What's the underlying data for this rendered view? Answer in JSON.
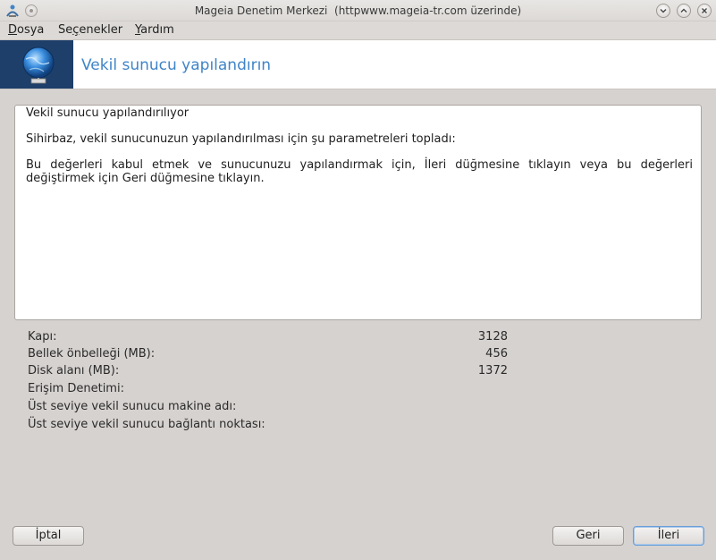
{
  "window": {
    "title": "Mageia Denetim Merkezi  (httpwww.mageia-tr.com üzerinde)"
  },
  "menu": {
    "file": {
      "mnemonic": "D",
      "rest": "osya"
    },
    "options": {
      "before": "Se",
      "mnemonic": "ç",
      "after": "enekler"
    },
    "help": {
      "mnemonic": "Y",
      "rest": "ardım"
    }
  },
  "banner": {
    "title": "Vekil sunucu yapılandırın"
  },
  "summary": {
    "heading": "Vekil sunucu yapılandırılıyor",
    "intro": "Sihirbaz, vekil sunucunuzun yapılandırılması için şu parametreleri topladı:",
    "instruction": "Bu değerleri kabul etmek ve sunucunuzu yapılandırmak için, İleri düğmesine tıklayın veya bu değerleri değiştirmek için Geri düğmesine tıklayın."
  },
  "parameters": [
    {
      "label": "Kapı:",
      "value": "3128"
    },
    {
      "label": "Bellek önbelleği (MB):",
      "value": "456"
    },
    {
      "label": "Disk alanı (MB):",
      "value": "1372"
    },
    {
      "label": "Erişim Denetimi:",
      "value": ""
    },
    {
      "label": "Üst seviye vekil sunucu makine adı:",
      "value": ""
    },
    {
      "label": "Üst seviye vekil sunucu bağlantı noktası:",
      "value": ""
    }
  ],
  "buttons": {
    "cancel": "İptal",
    "back": "Geri",
    "next": "İleri"
  }
}
